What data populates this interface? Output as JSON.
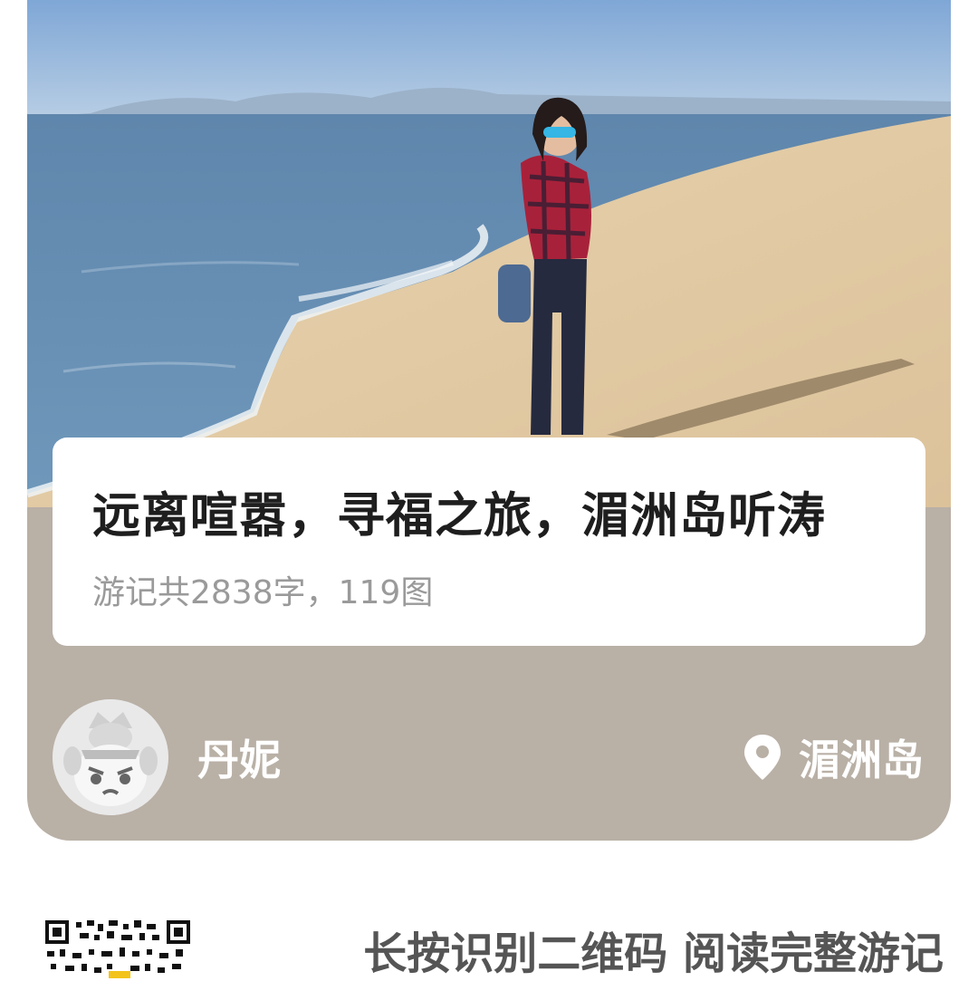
{
  "post": {
    "title": "远离喧嚣，寻福之旅，湄洲岛听涛",
    "meta": "游记共2838字，119图"
  },
  "author": {
    "name": "丹妮",
    "avatar_icon": "cartoon-avatar-icon"
  },
  "location": {
    "name": "湄洲岛",
    "icon": "location-pin-icon"
  },
  "footer": {
    "qr_icon": "qr-code-icon",
    "cta_text": "长按识别二维码 阅读完整游记"
  },
  "colors": {
    "card_background": "#b9b0a6",
    "panel_background": "#ffffff",
    "title": "#1e1e1e",
    "meta": "#9a9a9a",
    "cta": "#555555"
  }
}
